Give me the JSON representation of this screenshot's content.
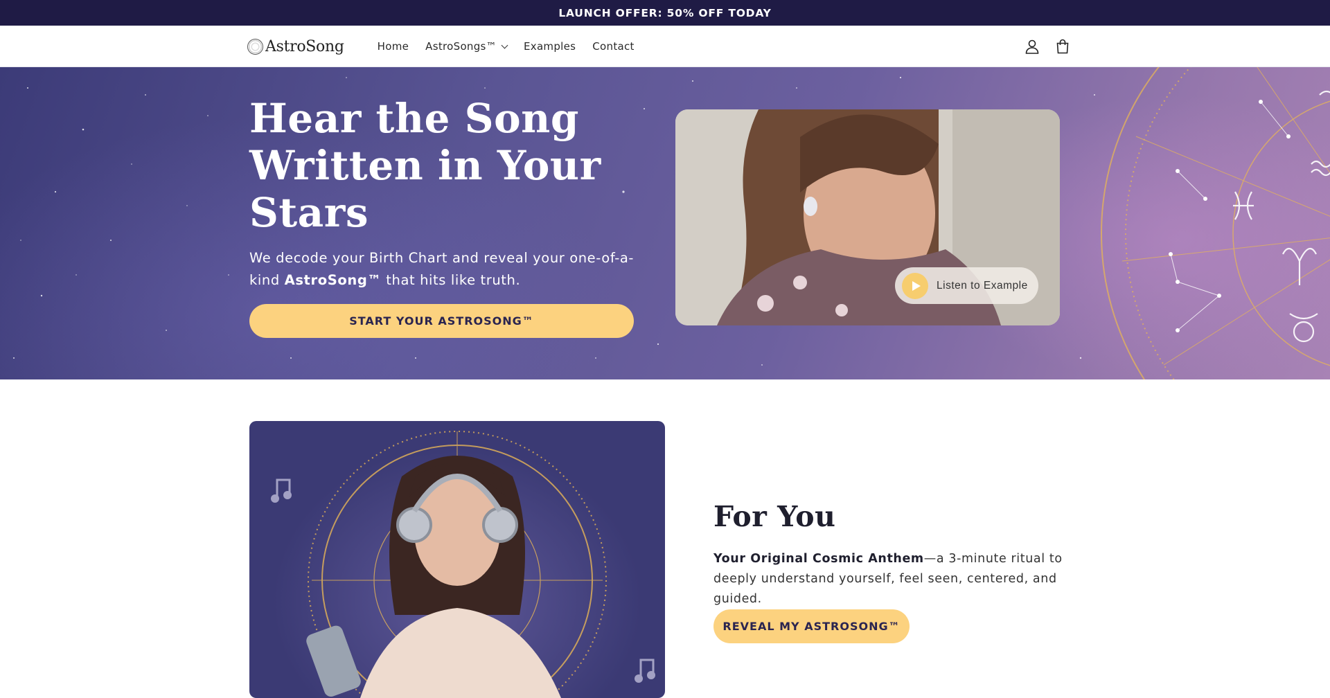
{
  "announcement": "LAUNCH OFFER: 50% OFF TODAY",
  "header": {
    "logo_text": "AstroSong",
    "nav": [
      {
        "label": "Home"
      },
      {
        "label": "AstroSongs™"
      },
      {
        "label": "Examples"
      },
      {
        "label": "Contact"
      }
    ],
    "icons": [
      "account-icon",
      "cart-icon"
    ]
  },
  "hero": {
    "title": "Hear the Song Written in Your Stars",
    "subtitle_pre": "We decode your Birth Chart and reveal your one-of-a-kind ",
    "subtitle_bold": "AstroSong™",
    "subtitle_post": " that hits like truth.",
    "cta": "START YOUR ASTROSONG™",
    "listen_label": "Listen to Example"
  },
  "for_you": {
    "title": "For You",
    "text_bold": "Your Original Cosmic Anthem",
    "text_rest": "—a 3-minute ritual to deeply understand yourself, feel seen, centered, and guided.",
    "cta": "REVEAL MY ASTROSONG™"
  },
  "colors": {
    "announcement_bg": "#1f1b45",
    "accent": "#fcd27f",
    "hero_purple": "#5a5594"
  }
}
